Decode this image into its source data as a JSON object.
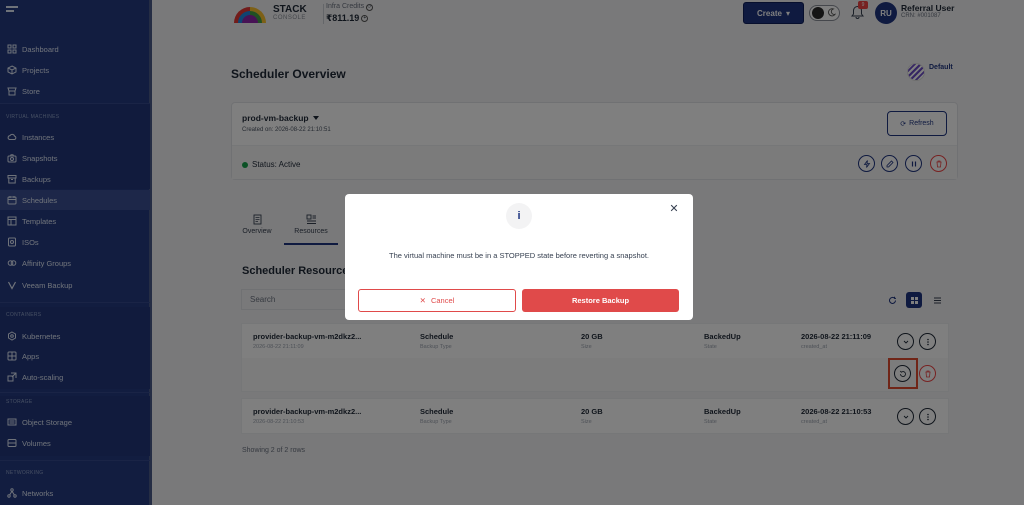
{
  "sidebar": {
    "items": [
      {
        "label": "Dashboard",
        "icon": "grid-icon"
      },
      {
        "label": "Projects",
        "icon": "cube-icon"
      },
      {
        "label": "Store",
        "icon": "store-icon"
      },
      {
        "label": "Instances",
        "icon": "cloud-icon"
      },
      {
        "label": "Snapshots",
        "icon": "camera-icon"
      },
      {
        "label": "Backups",
        "icon": "archive-icon"
      },
      {
        "label": "Schedules",
        "icon": "calendar-icon"
      },
      {
        "label": "Templates",
        "icon": "template-icon"
      },
      {
        "label": "ISOs",
        "icon": "disc-icon"
      },
      {
        "label": "Affinity Groups",
        "icon": "affinity-icon"
      },
      {
        "label": "Veeam Backup",
        "icon": "veeam-icon"
      },
      {
        "label": "Kubernetes",
        "icon": "kubernetes-icon"
      },
      {
        "label": "Apps",
        "icon": "apps-icon"
      },
      {
        "label": "Auto-scaling",
        "icon": "scaling-icon"
      },
      {
        "label": "Object Storage",
        "icon": "storage-icon"
      },
      {
        "label": "Volumes",
        "icon": "volume-icon"
      },
      {
        "label": "Networks",
        "icon": "network-icon"
      }
    ],
    "headings": {
      "virtual_machines": "VIRTUAL MACHINES",
      "containers": "CONTAINERS",
      "storage": "STORAGE",
      "networking": "NETWORKING"
    },
    "active": "Schedules"
  },
  "topbar": {
    "brand_main": "STACK",
    "brand_sub": "CONSOLE",
    "credits_label": "Infra Credits",
    "credits_value": "₹811.19",
    "create_label": "Create",
    "notification_count": "9",
    "avatar_initials": "RU",
    "user_name": "Referral User",
    "crn": "CRN: #001087"
  },
  "page": {
    "title": "Scheduler Overview",
    "default_label": "Default"
  },
  "scheduler": {
    "name": "prod-vm-backup",
    "created": "Created on: 2026-08-22 21:10:51",
    "refresh_label": "Refresh",
    "status": "Status: Active"
  },
  "tabs": [
    {
      "label": "Overview"
    },
    {
      "label": "Resources"
    }
  ],
  "resources": {
    "title": "Scheduler Resources",
    "search_placeholder": "Search",
    "rows": [
      {
        "name": "provider-backup-vm-m2dkz2...",
        "name_sub": "2026-08-22 21:11:09",
        "schedule": "Schedule",
        "schedule_sub": "Backup Type",
        "size": "20 GB",
        "size_sub": "Size",
        "state": "BackedUp",
        "state_sub": "State",
        "created": "2026-08-22 21:11:09",
        "created_sub": "created_at"
      },
      {
        "name": "provider-backup-vm-m2dkz2...",
        "name_sub": "2026-08-22 21:10:53",
        "schedule": "Schedule",
        "schedule_sub": "Backup Type",
        "size": "20 GB",
        "size_sub": "Size",
        "state": "BackedUp",
        "state_sub": "State",
        "created": "2026-08-22 21:10:53",
        "created_sub": "created_at"
      }
    ],
    "showing": "Showing 2 of 2 rows"
  },
  "modal": {
    "icon_text": "i",
    "message": "The virtual machine must be in a STOPPED state before reverting a snapshot.",
    "cancel_label": "Cancel",
    "restore_label": "Restore Backup"
  },
  "colors": {
    "sidebar_bg": "#253b80",
    "primary": "#1f3580",
    "danger": "#e04a4a",
    "success": "#16a34a"
  }
}
